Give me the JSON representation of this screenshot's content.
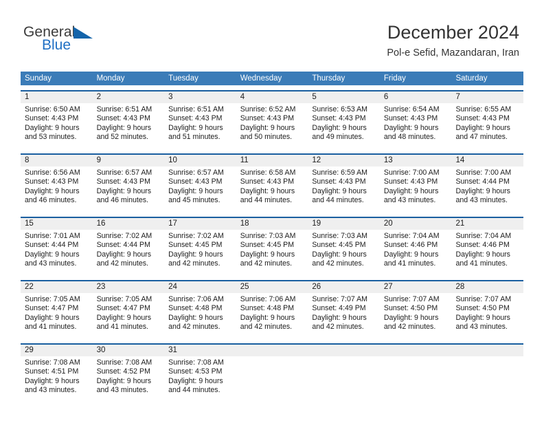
{
  "brand": {
    "name_part1": "General",
    "name_part2": "Blue",
    "triangle_icon": "triangle-icon",
    "accent_color": "#1464aa"
  },
  "header": {
    "title": "December 2024",
    "subtitle": "Pol-e Sefid, Mazandaran, Iran"
  },
  "colors": {
    "header_blue": "#3b7cb8",
    "row_divider_blue": "#1a5fa0",
    "day_band_gray": "#efefef",
    "brand_blue": "#1f6fc4"
  },
  "weekdays": [
    "Sunday",
    "Monday",
    "Tuesday",
    "Wednesday",
    "Thursday",
    "Friday",
    "Saturday"
  ],
  "weeks": [
    [
      {
        "day": "1",
        "sunrise": "Sunrise: 6:50 AM",
        "sunset": "Sunset: 4:43 PM",
        "daylight1": "Daylight: 9 hours",
        "daylight2": "and 53 minutes."
      },
      {
        "day": "2",
        "sunrise": "Sunrise: 6:51 AM",
        "sunset": "Sunset: 4:43 PM",
        "daylight1": "Daylight: 9 hours",
        "daylight2": "and 52 minutes."
      },
      {
        "day": "3",
        "sunrise": "Sunrise: 6:51 AM",
        "sunset": "Sunset: 4:43 PM",
        "daylight1": "Daylight: 9 hours",
        "daylight2": "and 51 minutes."
      },
      {
        "day": "4",
        "sunrise": "Sunrise: 6:52 AM",
        "sunset": "Sunset: 4:43 PM",
        "daylight1": "Daylight: 9 hours",
        "daylight2": "and 50 minutes."
      },
      {
        "day": "5",
        "sunrise": "Sunrise: 6:53 AM",
        "sunset": "Sunset: 4:43 PM",
        "daylight1": "Daylight: 9 hours",
        "daylight2": "and 49 minutes."
      },
      {
        "day": "6",
        "sunrise": "Sunrise: 6:54 AM",
        "sunset": "Sunset: 4:43 PM",
        "daylight1": "Daylight: 9 hours",
        "daylight2": "and 48 minutes."
      },
      {
        "day": "7",
        "sunrise": "Sunrise: 6:55 AM",
        "sunset": "Sunset: 4:43 PM",
        "daylight1": "Daylight: 9 hours",
        "daylight2": "and 47 minutes."
      }
    ],
    [
      {
        "day": "8",
        "sunrise": "Sunrise: 6:56 AM",
        "sunset": "Sunset: 4:43 PM",
        "daylight1": "Daylight: 9 hours",
        "daylight2": "and 46 minutes."
      },
      {
        "day": "9",
        "sunrise": "Sunrise: 6:57 AM",
        "sunset": "Sunset: 4:43 PM",
        "daylight1": "Daylight: 9 hours",
        "daylight2": "and 46 minutes."
      },
      {
        "day": "10",
        "sunrise": "Sunrise: 6:57 AM",
        "sunset": "Sunset: 4:43 PM",
        "daylight1": "Daylight: 9 hours",
        "daylight2": "and 45 minutes."
      },
      {
        "day": "11",
        "sunrise": "Sunrise: 6:58 AM",
        "sunset": "Sunset: 4:43 PM",
        "daylight1": "Daylight: 9 hours",
        "daylight2": "and 44 minutes."
      },
      {
        "day": "12",
        "sunrise": "Sunrise: 6:59 AM",
        "sunset": "Sunset: 4:43 PM",
        "daylight1": "Daylight: 9 hours",
        "daylight2": "and 44 minutes."
      },
      {
        "day": "13",
        "sunrise": "Sunrise: 7:00 AM",
        "sunset": "Sunset: 4:43 PM",
        "daylight1": "Daylight: 9 hours",
        "daylight2": "and 43 minutes."
      },
      {
        "day": "14",
        "sunrise": "Sunrise: 7:00 AM",
        "sunset": "Sunset: 4:44 PM",
        "daylight1": "Daylight: 9 hours",
        "daylight2": "and 43 minutes."
      }
    ],
    [
      {
        "day": "15",
        "sunrise": "Sunrise: 7:01 AM",
        "sunset": "Sunset: 4:44 PM",
        "daylight1": "Daylight: 9 hours",
        "daylight2": "and 43 minutes."
      },
      {
        "day": "16",
        "sunrise": "Sunrise: 7:02 AM",
        "sunset": "Sunset: 4:44 PM",
        "daylight1": "Daylight: 9 hours",
        "daylight2": "and 42 minutes."
      },
      {
        "day": "17",
        "sunrise": "Sunrise: 7:02 AM",
        "sunset": "Sunset: 4:45 PM",
        "daylight1": "Daylight: 9 hours",
        "daylight2": "and 42 minutes."
      },
      {
        "day": "18",
        "sunrise": "Sunrise: 7:03 AM",
        "sunset": "Sunset: 4:45 PM",
        "daylight1": "Daylight: 9 hours",
        "daylight2": "and 42 minutes."
      },
      {
        "day": "19",
        "sunrise": "Sunrise: 7:03 AM",
        "sunset": "Sunset: 4:45 PM",
        "daylight1": "Daylight: 9 hours",
        "daylight2": "and 42 minutes."
      },
      {
        "day": "20",
        "sunrise": "Sunrise: 7:04 AM",
        "sunset": "Sunset: 4:46 PM",
        "daylight1": "Daylight: 9 hours",
        "daylight2": "and 41 minutes."
      },
      {
        "day": "21",
        "sunrise": "Sunrise: 7:04 AM",
        "sunset": "Sunset: 4:46 PM",
        "daylight1": "Daylight: 9 hours",
        "daylight2": "and 41 minutes."
      }
    ],
    [
      {
        "day": "22",
        "sunrise": "Sunrise: 7:05 AM",
        "sunset": "Sunset: 4:47 PM",
        "daylight1": "Daylight: 9 hours",
        "daylight2": "and 41 minutes."
      },
      {
        "day": "23",
        "sunrise": "Sunrise: 7:05 AM",
        "sunset": "Sunset: 4:47 PM",
        "daylight1": "Daylight: 9 hours",
        "daylight2": "and 41 minutes."
      },
      {
        "day": "24",
        "sunrise": "Sunrise: 7:06 AM",
        "sunset": "Sunset: 4:48 PM",
        "daylight1": "Daylight: 9 hours",
        "daylight2": "and 42 minutes."
      },
      {
        "day": "25",
        "sunrise": "Sunrise: 7:06 AM",
        "sunset": "Sunset: 4:48 PM",
        "daylight1": "Daylight: 9 hours",
        "daylight2": "and 42 minutes."
      },
      {
        "day": "26",
        "sunrise": "Sunrise: 7:07 AM",
        "sunset": "Sunset: 4:49 PM",
        "daylight1": "Daylight: 9 hours",
        "daylight2": "and 42 minutes."
      },
      {
        "day": "27",
        "sunrise": "Sunrise: 7:07 AM",
        "sunset": "Sunset: 4:50 PM",
        "daylight1": "Daylight: 9 hours",
        "daylight2": "and 42 minutes."
      },
      {
        "day": "28",
        "sunrise": "Sunrise: 7:07 AM",
        "sunset": "Sunset: 4:50 PM",
        "daylight1": "Daylight: 9 hours",
        "daylight2": "and 43 minutes."
      }
    ],
    [
      {
        "day": "29",
        "sunrise": "Sunrise: 7:08 AM",
        "sunset": "Sunset: 4:51 PM",
        "daylight1": "Daylight: 9 hours",
        "daylight2": "and 43 minutes."
      },
      {
        "day": "30",
        "sunrise": "Sunrise: 7:08 AM",
        "sunset": "Sunset: 4:52 PM",
        "daylight1": "Daylight: 9 hours",
        "daylight2": "and 43 minutes."
      },
      {
        "day": "31",
        "sunrise": "Sunrise: 7:08 AM",
        "sunset": "Sunset: 4:53 PM",
        "daylight1": "Daylight: 9 hours",
        "daylight2": "and 44 minutes."
      },
      {
        "day": "",
        "sunrise": "",
        "sunset": "",
        "daylight1": "",
        "daylight2": ""
      },
      {
        "day": "",
        "sunrise": "",
        "sunset": "",
        "daylight1": "",
        "daylight2": ""
      },
      {
        "day": "",
        "sunrise": "",
        "sunset": "",
        "daylight1": "",
        "daylight2": ""
      },
      {
        "day": "",
        "sunrise": "",
        "sunset": "",
        "daylight1": "",
        "daylight2": ""
      }
    ]
  ]
}
